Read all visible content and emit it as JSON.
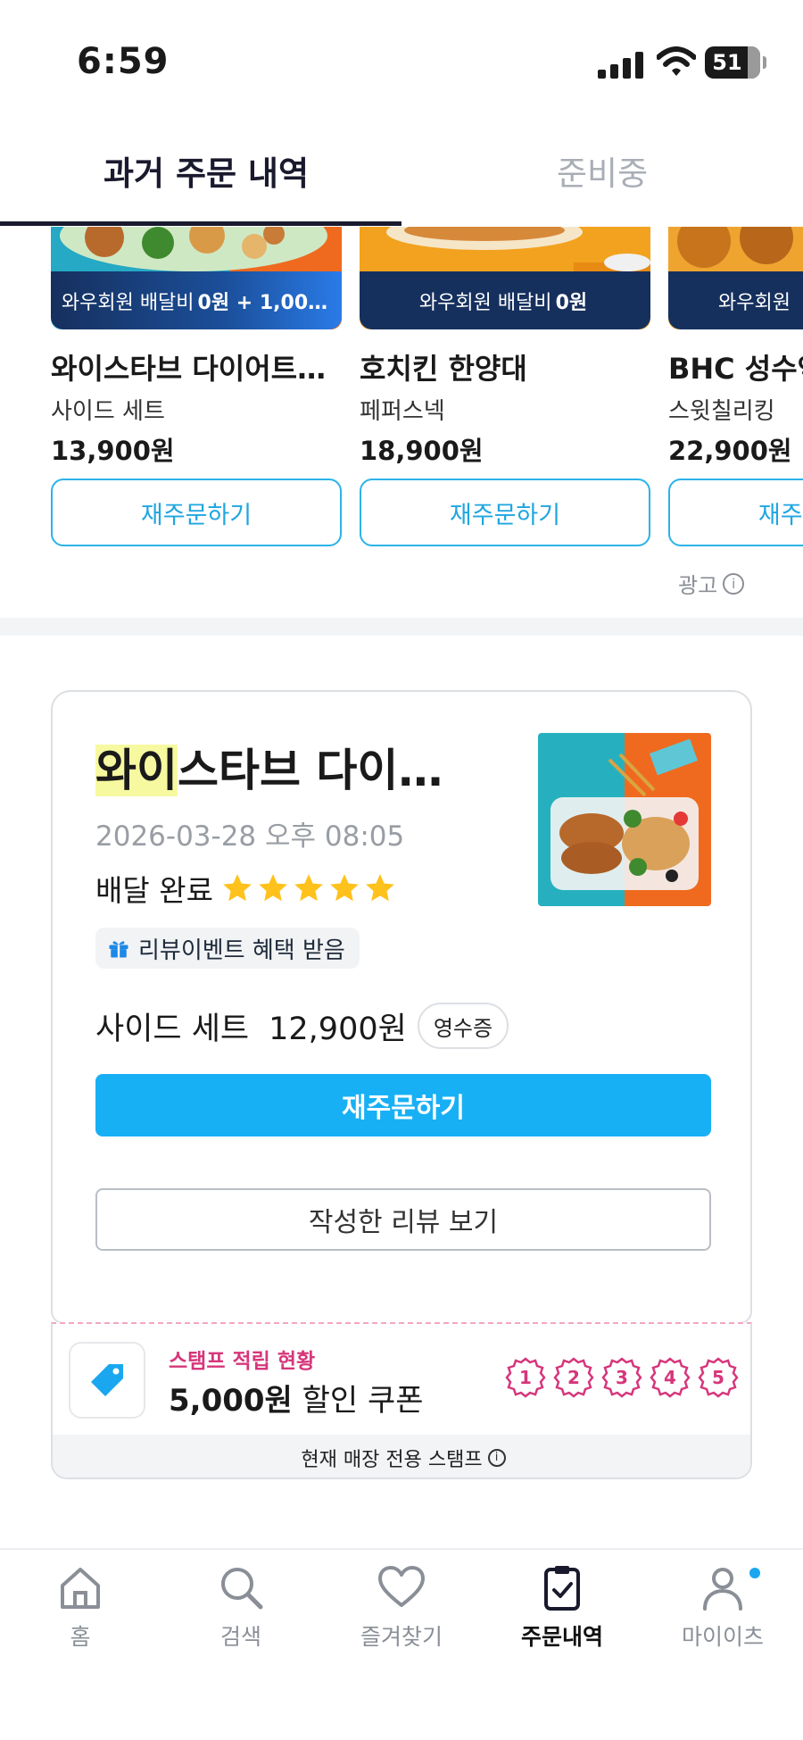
{
  "status_bar": {
    "time": "6:59",
    "battery": "51"
  },
  "tabs": [
    {
      "label": "과거 주문 내역",
      "active": true
    },
    {
      "label": "준비중",
      "active": false
    }
  ],
  "recommendations": [
    {
      "badge_prefix": "와우회원 배달비",
      "badge_bold": "0원 + 1,00…",
      "name": "와이스타브 다이어트…",
      "sub": "사이드 세트",
      "price": "13,900원",
      "button": "재주문하기"
    },
    {
      "badge_prefix": "와우회원 배달비",
      "badge_bold": "0원",
      "name": "호치킨 한양대",
      "sub": "페퍼스넥",
      "price": "18,900원",
      "button": "재주문하기"
    },
    {
      "badge_prefix": "와우회원",
      "badge_bold": "",
      "name": "BHC 성수역",
      "sub": "스윗칠리킹",
      "price": "22,900원",
      "button": "재주문하기"
    }
  ],
  "ad_label": "광고",
  "order": {
    "store_highlight": "와이",
    "store_rest": "스타브 다이…",
    "date": "2026-03-28 오후 08:05",
    "status": "배달 완료",
    "rating": 5,
    "event_badge": "리뷰이벤트 혜택 받음",
    "item": "사이드 세트",
    "price": "12,900원",
    "receipt": "영수증",
    "reorder_button": "재주문하기",
    "review_button": "작성한 리뷰 보기"
  },
  "stamp": {
    "title": "스탬프 적립 현황",
    "coupon_amount": "5,000원",
    "coupon_text": " 할인 쿠폰",
    "stamps": [
      "1",
      "2",
      "3",
      "4",
      "5"
    ],
    "footer": "현재 매장 전용 스탬프"
  },
  "bottom_nav": [
    {
      "label": "홈",
      "icon": "home-icon"
    },
    {
      "label": "검색",
      "icon": "search-icon"
    },
    {
      "label": "즐겨찾기",
      "icon": "heart-icon"
    },
    {
      "label": "주문내역",
      "icon": "clipboard-check-icon",
      "active": true
    },
    {
      "label": "마이이츠",
      "icon": "person-icon"
    }
  ],
  "colors": {
    "accent": "#18b0f5",
    "stamp_pink": "#d6367a",
    "badge_navy": "#16305e"
  }
}
